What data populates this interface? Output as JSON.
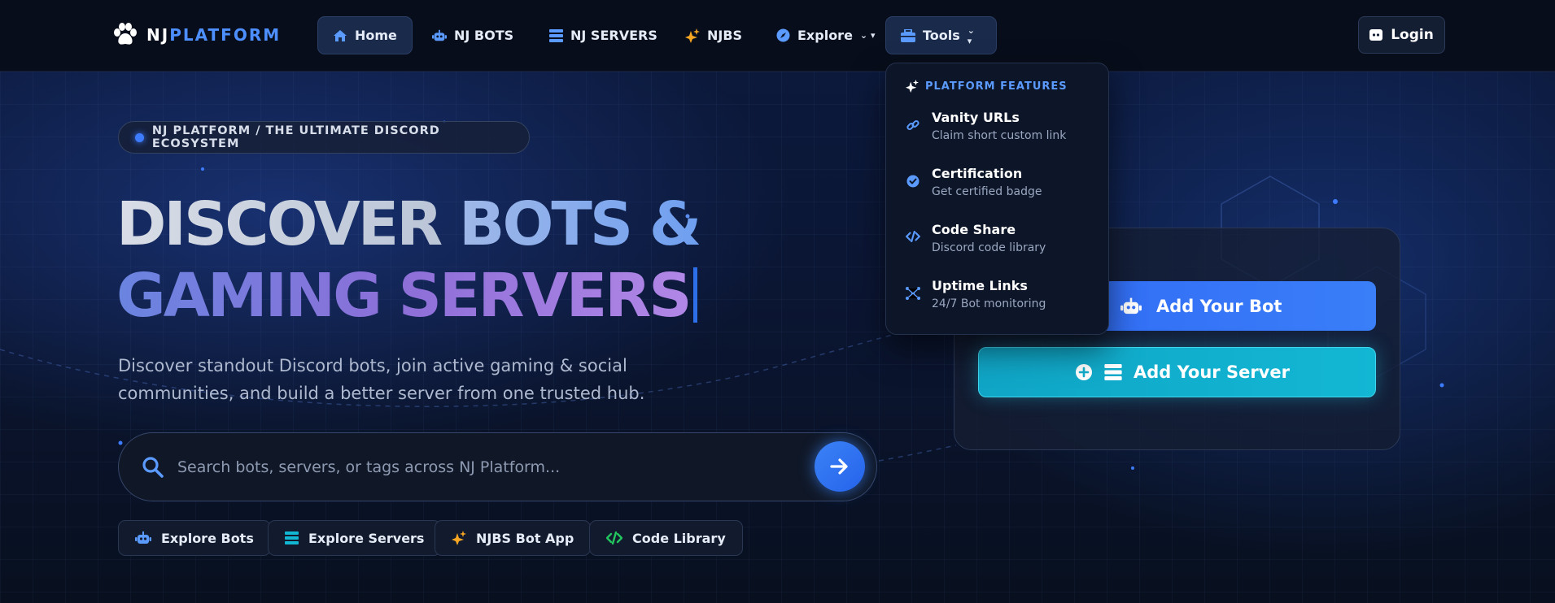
{
  "brand": {
    "part1": "NJ",
    "part2": "PLATFORM",
    "logo_icon": "paw-icon"
  },
  "nav": {
    "home": "Home",
    "bots": "NJ BOTS",
    "servers": "NJ SERVERS",
    "njbs": "NJBS",
    "explore": "Explore",
    "tools": "Tools",
    "login": "Login"
  },
  "tools_menu": {
    "header": "PLATFORM FEATURES",
    "items": [
      {
        "title": "Vanity URLs",
        "subtitle": "Claim short custom link",
        "icon": "link-icon"
      },
      {
        "title": "Certification",
        "subtitle": "Get certified badge",
        "icon": "certified-icon"
      },
      {
        "title": "Code Share",
        "subtitle": "Discord code library",
        "icon": "code-icon"
      },
      {
        "title": "Uptime Links",
        "subtitle": "24/7 Bot monitoring",
        "icon": "nodes-icon"
      }
    ]
  },
  "hero": {
    "badge": "NJ PLATFORM / THE ULTIMATE DISCORD ECOSYSTEM",
    "headline_line1_a": "DISCOVER ",
    "headline_line1_b": "BOTS &",
    "headline_line2": "GAMING SERVERS",
    "lead": "Discover standout Discord bots, join active gaming & social communities, and build a better server from one trusted hub."
  },
  "search": {
    "placeholder": "Search bots, servers, or tags across NJ Platform...",
    "value": ""
  },
  "quick_links": [
    "Explore Bots",
    "Explore Servers",
    "NJBS Bot App",
    "Code Library"
  ],
  "card": {
    "add_bot": "Add Your Bot",
    "add_server": "Add Your Server"
  },
  "colors": {
    "accent": "#3b82f6",
    "brand_blue": "#4d8fff",
    "cyan": "#12b7d4",
    "njbs_orange": "#f6a623",
    "code_green": "#22c55e"
  }
}
